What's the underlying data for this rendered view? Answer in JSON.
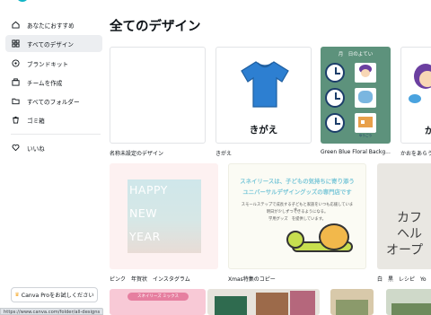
{
  "sidebar": {
    "items": [
      {
        "label": "あなたにおすすめ",
        "icon": "home-icon"
      },
      {
        "label": "すべてのデザイン",
        "icon": "grid-icon"
      },
      {
        "label": "ブランドキット",
        "icon": "brand-kit-icon"
      },
      {
        "label": "チームを作成",
        "icon": "team-icon"
      },
      {
        "label": "すべてのフォルダー",
        "icon": "folder-icon"
      },
      {
        "label": "ゴミ箱",
        "icon": "trash-icon"
      }
    ],
    "likes_label": "いいね",
    "canva_pro_label": "Canva Proをお試しください"
  },
  "status_url": "https://www.canva.com/folder/all-designs",
  "page_title": "全てのデザイン",
  "designs": {
    "d1": {
      "caption": "名称未設定のデザイン"
    },
    "d2": {
      "caption": "きがえ",
      "text": "きがえ"
    },
    "d3": {
      "caption": "Green Blue Floral Backg...",
      "header": "月　日のよてい",
      "bottom_label": "ゆうごう"
    },
    "d4": {
      "caption": "かおをあらう",
      "text": "か"
    },
    "d5": {
      "caption": "ピンク　年賀状　インスタグラム",
      "lines": [
        "HAPPY",
        "NEW",
        "YEAR"
      ]
    },
    "d6": {
      "caption": "Xmas特集のコピー",
      "line1": "スネイリースは、子どもの気持ちに寄り添う",
      "line2": "ユニバーサルデザイングッズの専門店です",
      "small1": "スモールステップで成長する子どもと家族をいつも応援しています。",
      "small2": "明日が少しずつできるようになる。",
      "small3": "学用グッズ　を提供しています。"
    },
    "d7": {
      "caption": "白　黒　レシピ　Yo",
      "lines": [
        "カフ",
        "ヘル",
        "オープ"
      ]
    },
    "d8": {
      "text": "スネイリーズ ミックス"
    }
  },
  "colors": {
    "shirt": "#2d7fd1",
    "floral_bg": "#5d927c",
    "clock_border": "#1c3e6a",
    "xmas_text": "#7ac7d8",
    "sidebar_active": "#eceef1"
  }
}
